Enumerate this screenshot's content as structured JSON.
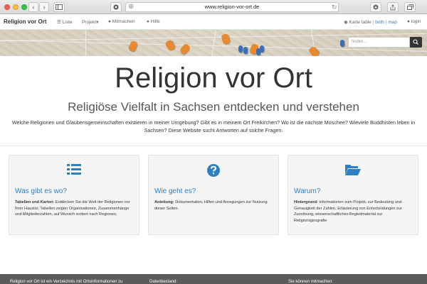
{
  "browser": {
    "url": "www.religion-vor-ort.de",
    "controls": {
      "back": "‹",
      "forward": "›"
    }
  },
  "navbar": {
    "brand": "Religion vor Ort",
    "items": [
      {
        "icon": "list-icon",
        "label": "Liste"
      },
      {
        "label": "Projekt▾"
      },
      {
        "icon": "user-icon",
        "label": "Mitmachen"
      },
      {
        "icon": "help-icon",
        "label": "Hilfe"
      }
    ],
    "view_switch": {
      "prefix": "Karte table",
      "sep": "|",
      "both": "both",
      "map": "map"
    },
    "login": "login"
  },
  "search": {
    "placeholder": "finden..."
  },
  "hero": {
    "title": "Religion vor Ort",
    "subtitle": "Religiöse Vielfalt in Sachsen entdecken und verstehen",
    "description": "Welche Religionen und Glaubensgemeinschaften existieren in meiner Umgebung? Gibt es in meinem Ort Freikirchen? Wo ist die nächste Moschee? Wieviele Buddhisten leben in Sachsen? Diese Website sucht Antworten auf solche Fragen."
  },
  "cards": [
    {
      "icon": "list-icon",
      "title": "Was gibt es wo?",
      "lead": "Tabellen und Karten:",
      "text": " Entdecken Sie die Welt der Religionen vor Ihrer Haustür. Tabellen zeigen Organisationen, Zusammenhänge und Mitgliederzahlen, auf Wunsch sortiert nach Regionen."
    },
    {
      "icon": "question-icon",
      "title": "Wie geht es?",
      "lead": "Anleitung:",
      "text": " Dokumentation, Hilfen und Anregungen zur Nutzung dieser Seiten."
    },
    {
      "icon": "folder-open-icon",
      "title": "Warum?",
      "lead": "Hintergrund:",
      "text": " Informationen zum Projekt, zur Bedeutung und Genauigkeit der Zahlen, Erläuterung von Entscheidungen zur Zuordnung, wissenschaftliches Begleitmaterial zur Religionsgeografie"
    }
  ],
  "footer": {
    "col1": "Religion vor Ort ist ein Verzeichnis mit Ortsinformationen zu",
    "col2": "Datenbestand:",
    "col3": "Sie können mitmachen:"
  },
  "colors": {
    "link": "#2f80c2",
    "footer_bg": "#5b5b5b",
    "pin_orange": "#e8892e",
    "pin_blue": "#3a6fb5"
  }
}
